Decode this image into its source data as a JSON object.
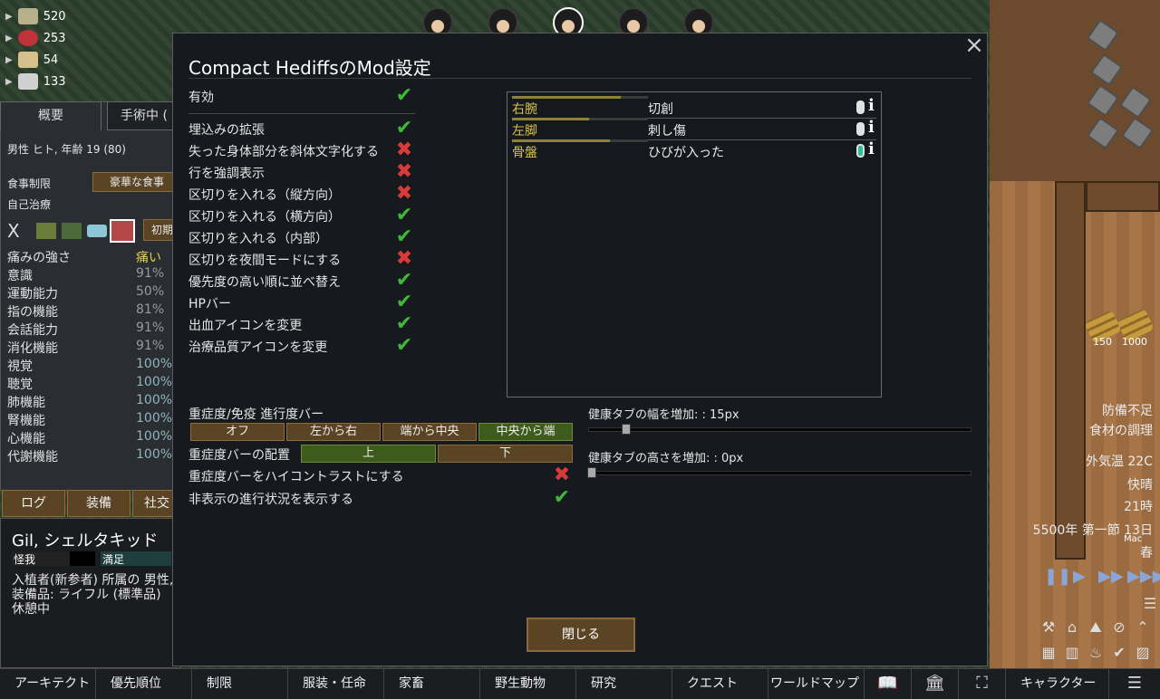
{
  "resources": [
    {
      "count": "520",
      "color": "#b8b08a"
    },
    {
      "count": "253",
      "color": "#c0333a"
    },
    {
      "count": "54",
      "color": "#d8c08a"
    },
    {
      "count": "133",
      "color": "#d0d0d0"
    }
  ],
  "inspect": {
    "tabs": [
      "概要",
      "手術中 ("
    ],
    "header": "男性 ヒト, 年齢 19 (80)",
    "food_label": "食事制限",
    "food_value": "豪華な食事",
    "self_tend": "自己治療",
    "first_aid": "初期",
    "x_mark": "X",
    "capacities": [
      {
        "name": "痛みの強さ",
        "value": "痛い",
        "style": "yellow"
      },
      {
        "name": "意識",
        "value": "91%",
        "style": "dim"
      },
      {
        "name": "運動能力",
        "value": "50%",
        "style": "dim"
      },
      {
        "name": "指の機能",
        "value": "81%",
        "style": "dim"
      },
      {
        "name": "会話能力",
        "value": "91%",
        "style": "dim"
      },
      {
        "name": "消化機能",
        "value": "91%",
        "style": "dim"
      },
      {
        "name": "視覚",
        "value": "100%",
        "style": "good"
      },
      {
        "name": "聴覚",
        "value": "100%",
        "style": "good"
      },
      {
        "name": "肺機能",
        "value": "100%",
        "style": "good"
      },
      {
        "name": "腎機能",
        "value": "100%",
        "style": "good"
      },
      {
        "name": "心機能",
        "value": "100%",
        "style": "good"
      },
      {
        "name": "代謝機能",
        "value": "100%",
        "style": "good"
      }
    ]
  },
  "pawn": {
    "tabs": [
      "ログ",
      "装備",
      "社交"
    ],
    "name": "Gil, シェルタキッド",
    "need_injured": "怪我",
    "need_satisfied": "満足",
    "line1": "入植者(新参者) 所属の 男性,",
    "line2": "装備品: ライフル (標準品)",
    "line3": "休憩中"
  },
  "dialog": {
    "title": "Compact HediffsのMod設定",
    "close_icon": "×",
    "enabled": {
      "label": "有効",
      "value": true
    },
    "options": [
      {
        "label": "埋込みの拡張",
        "value": true
      },
      {
        "label": "失った身体部分を斜体文字化する",
        "value": false
      },
      {
        "label": "行を強調表示",
        "value": false
      },
      {
        "label": "区切りを入れる（縦方向）",
        "value": false
      },
      {
        "label": "区切りを入れる（横方向）",
        "value": true
      },
      {
        "label": "区切りを入れる（内部）",
        "value": true
      },
      {
        "label": "区切りを夜間モードにする",
        "value": false
      },
      {
        "label": "優先度の高い順に並べ替え",
        "value": true
      },
      {
        "label": "HPバー",
        "value": true
      },
      {
        "label": "出血アイコンを変更",
        "value": true
      },
      {
        "label": "治療品質アイコンを変更",
        "value": true
      }
    ],
    "preview_rows": [
      {
        "part": "右腕",
        "injury": "切創",
        "hp": 0.8,
        "pill": "white"
      },
      {
        "part": "左脚",
        "injury": "刺し傷",
        "hp": 0.57,
        "pill": "white"
      },
      {
        "part": "骨盤",
        "injury": "ひびが入った",
        "hp": 0.72,
        "pill": "teal"
      }
    ],
    "info_glyph": "i",
    "severity_bar": {
      "label": "重症度/免疫 進行度バー",
      "options": [
        "オフ",
        "左から右",
        "端から中央",
        "中央から端"
      ],
      "selected": "中央から端"
    },
    "bar_position": {
      "label": "重症度バーの配置",
      "options": [
        "上",
        "下"
      ],
      "selected": "上"
    },
    "high_contrast": {
      "label": "重症度バーをハイコントラストにする",
      "value": false
    },
    "show_hidden": {
      "label": "非表示の進行状況を表示する",
      "value": true
    },
    "width_slider": {
      "label": "健康タブの幅を増加: : 15px",
      "value": 0.05
    },
    "height_slider": {
      "label": "健康タブの高さを増加: : 0px",
      "value": 0
    },
    "close_button": "閉じる",
    "check_glyph": "✔",
    "cross_glyph": "✖"
  },
  "hud": {
    "stock1": "150",
    "stock2": "1000",
    "alert1": "防備不足",
    "alert2": "食材の調理",
    "temp": "外気温 22C",
    "mood": "快晴",
    "time": "21時",
    "date": "5500年 第一節 13日",
    "season": "春",
    "mac": "Mac"
  },
  "bottom_bar": {
    "architect": "アーキテクト",
    "priority": "優先順位",
    "restrict": "制限",
    "assign": "服装・任命",
    "animals": "家畜",
    "wildlife": "野生動物",
    "research": "研究",
    "quests": "クエスト",
    "world": "ワールドマップ",
    "characters": "キャラクター"
  }
}
